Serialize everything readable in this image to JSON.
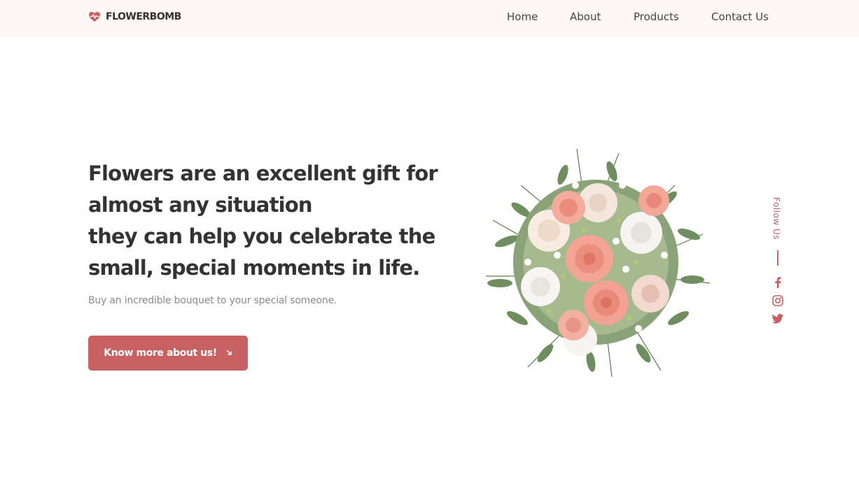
{
  "brand": {
    "name": "FLOWERBOMB",
    "icon": "heart-pulse-icon"
  },
  "nav": {
    "items": [
      {
        "label": "Home"
      },
      {
        "label": "About"
      },
      {
        "label": "Products"
      },
      {
        "label": "Contact Us"
      }
    ]
  },
  "hero": {
    "title_lines": [
      "Flowers are an excellent gift for",
      "almost any situation",
      "they can help you celebrate the",
      "small, special moments in life."
    ],
    "subtitle": "Buy an incredible bouquet to your special someone.",
    "cta_label": "Know more about us!",
    "cta_icon": "arrow-down-right-icon"
  },
  "social": {
    "label": "Follow Us",
    "icons": [
      "facebook-icon",
      "instagram-icon",
      "twitter-icon"
    ]
  },
  "colors": {
    "accent": "#c86262",
    "navbar_bg": "#fdf7f6",
    "heading": "#333333",
    "muted": "#8a8a8a"
  }
}
